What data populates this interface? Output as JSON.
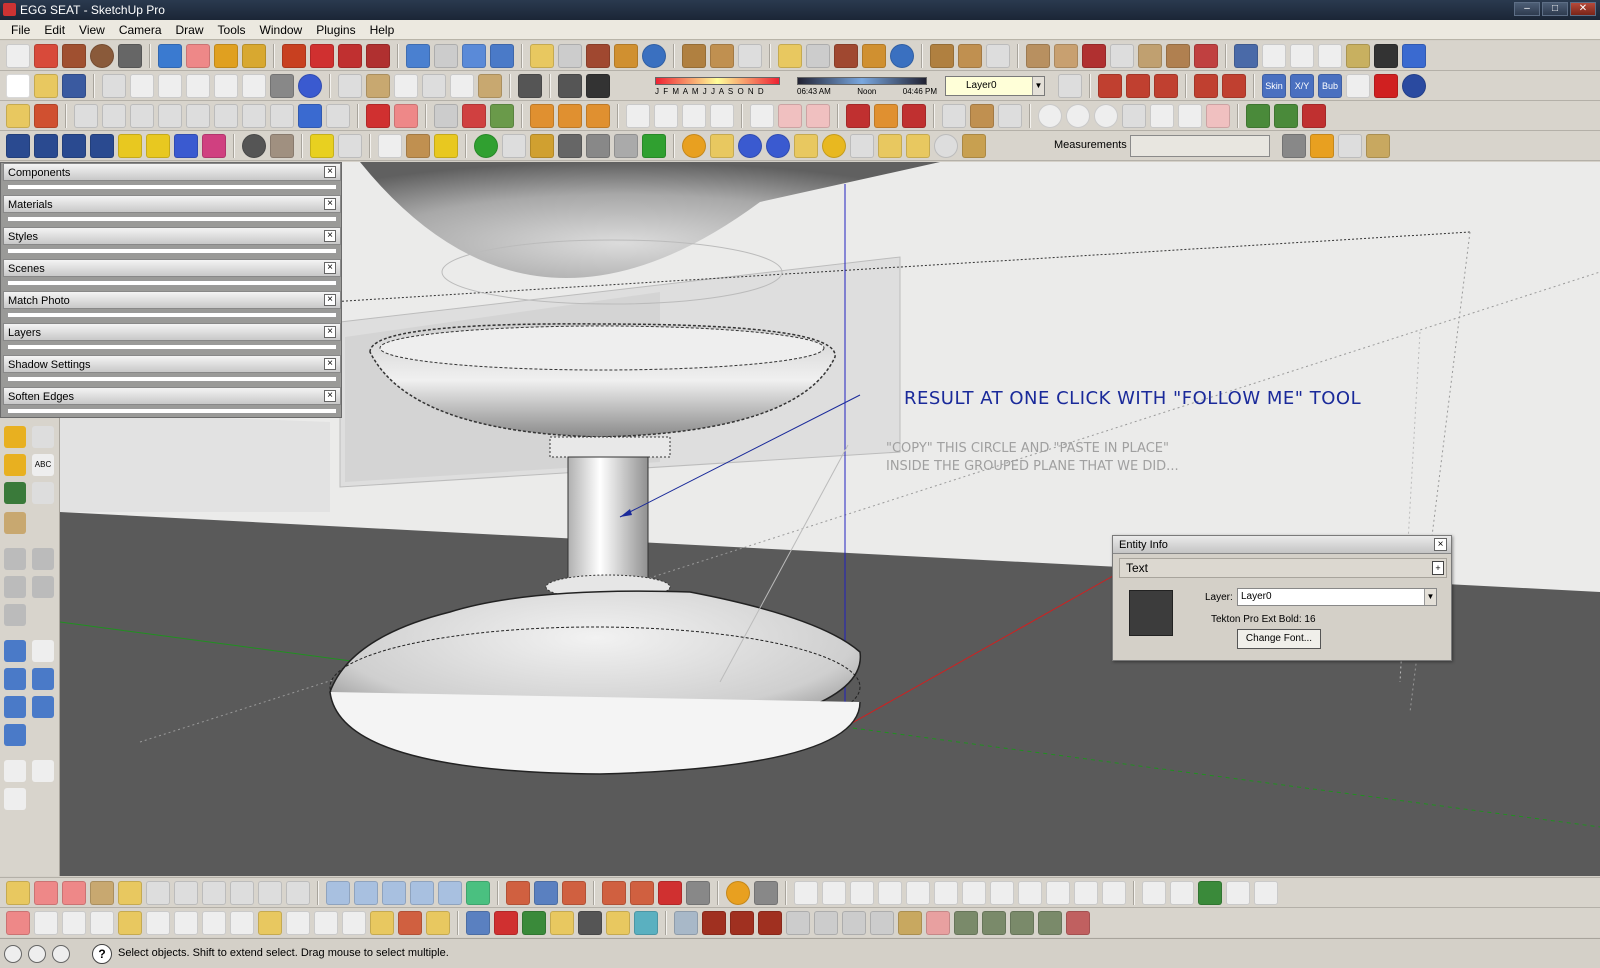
{
  "window": {
    "title": "EGG SEAT - SketchUp Pro",
    "controls": [
      "–",
      "□",
      "✕"
    ]
  },
  "menu": [
    "File",
    "Edit",
    "View",
    "Camera",
    "Draw",
    "Tools",
    "Window",
    "Plugins",
    "Help"
  ],
  "shadow_bar": {
    "months": "J F M A M J J A S O N D",
    "time_start": "06:43 AM",
    "time_mid": "Noon",
    "time_end": "04:46 PM"
  },
  "layer_dropdown": {
    "value": "Layer0"
  },
  "plugin_labels": [
    "Skin",
    "X/Y",
    "Bub"
  ],
  "measurements": {
    "label": "Measurements",
    "value": ""
  },
  "trays": [
    {
      "title": "Components"
    },
    {
      "title": "Materials"
    },
    {
      "title": "Styles"
    },
    {
      "title": "Scenes"
    },
    {
      "title": "Match Photo"
    },
    {
      "title": "Layers"
    },
    {
      "title": "Shadow Settings"
    },
    {
      "title": "Soften Edges"
    }
  ],
  "left_toolbar": {
    "text_tool_label": "ABC"
  },
  "annotations": {
    "result": "RESULT AT ONE CLICK WITH \"FOLLOW ME\" TOOL",
    "copy_line1": "\"COPY\" THIS CIRCLE AND \"PASTE IN PLACE\"",
    "copy_line2": "INSIDE THE GROUPED PLANE THAT WE DID..."
  },
  "entity_info": {
    "title": "Entity Info",
    "type": "Text",
    "layer_label": "Layer:",
    "layer_value": "Layer0",
    "font_info": "Tekton Pro Ext  Bold: 16",
    "change_font": "Change Font..."
  },
  "status": {
    "text": "Select objects. Shift to extend select. Drag mouse to select multiple."
  },
  "colors": {
    "title_bar": "#1b2636",
    "annotation_blue": "#1a2a9a",
    "ground": "#5a5a5a",
    "axis_red": "#d02020",
    "axis_green": "#209020",
    "axis_blue": "#2020c0"
  }
}
